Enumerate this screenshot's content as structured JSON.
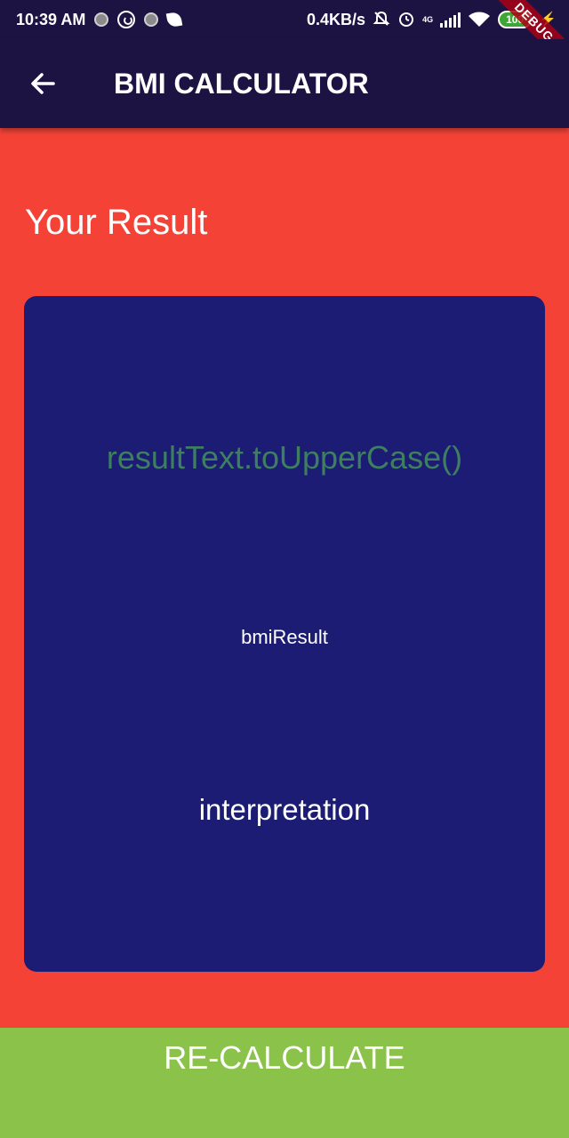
{
  "status_bar": {
    "time": "10:39 AM",
    "speed": "0.4KB/s",
    "network": "4G",
    "battery": "100"
  },
  "debug_banner": "DEBUG",
  "app_bar": {
    "title": "BMI CALCULATOR",
    "back_icon": "arrow-back-icon"
  },
  "page": {
    "title": "Your Result"
  },
  "result_card": {
    "result_text": "resultText.toUpperCase()",
    "bmi_result": "bmiResult",
    "interpretation": "interpretation"
  },
  "recalculate_button": {
    "label": "RE-CALCULATE"
  },
  "colors": {
    "background": "#f44336",
    "app_bar": "#1c1343",
    "card": "#1c1c74",
    "result_text": "#3d7f5f",
    "button": "#8bc34a"
  }
}
